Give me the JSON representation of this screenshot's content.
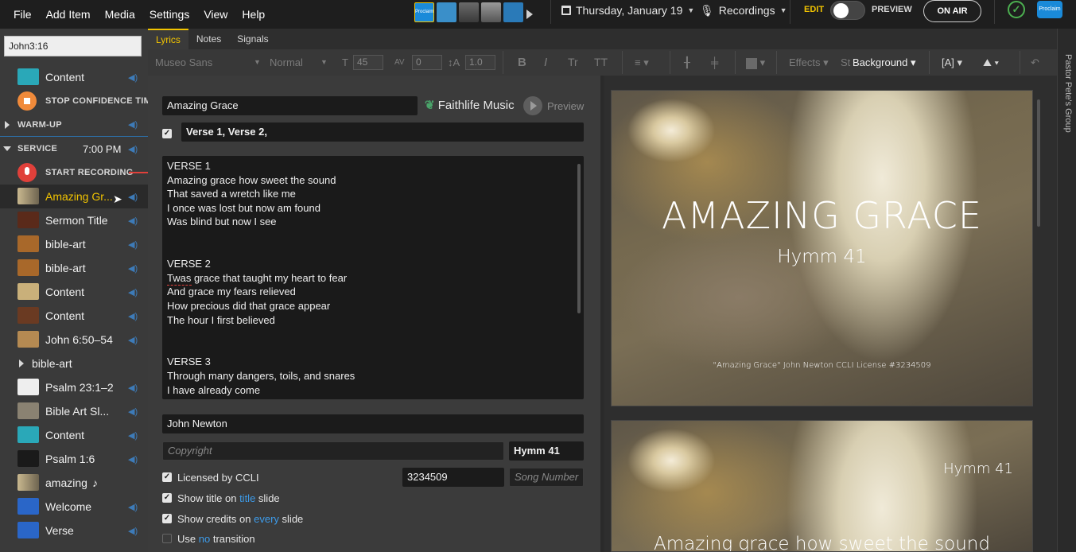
{
  "menu": [
    "File",
    "Add Item",
    "Media",
    "Settings",
    "View",
    "Help"
  ],
  "header": {
    "date": "Thursday, January 19",
    "recordings": "Recordings",
    "edit": "EDIT",
    "preview": "PREVIEW",
    "on_air": "ON AIR",
    "profile_badge": "Proclaim",
    "thumb_badge": "Proclaim"
  },
  "sidebar": {
    "search_value": "John3:16",
    "items": [
      {
        "label": "Content"
      },
      {
        "label": "STOP CONFIDENCE TIME"
      },
      {
        "label": "WARM-UP"
      },
      {
        "label": "SERVICE",
        "time": "7:00 PM"
      },
      {
        "label": "START RECORDING"
      },
      {
        "label": "Amazing Gr..."
      },
      {
        "label": "Sermon Title"
      },
      {
        "label": "bible-art"
      },
      {
        "label": "bible-art"
      },
      {
        "label": "Content"
      },
      {
        "label": "Content"
      },
      {
        "label": "John 6:50–54"
      },
      {
        "label": "bible-art"
      },
      {
        "label": "Psalm 23:1–2"
      },
      {
        "label": "Bible Art Sl..."
      },
      {
        "label": "Content"
      },
      {
        "label": "Psalm 1:6"
      },
      {
        "label": "amazing"
      },
      {
        "label": "Welcome"
      },
      {
        "label": "Verse"
      }
    ],
    "music_note": "♪"
  },
  "tabs": [
    "Lyrics",
    "Notes",
    "Signals"
  ],
  "toolbar": {
    "font": "Museo Sans",
    "weight": "Normal",
    "size": "45",
    "spacing": "0",
    "line_height": "1.0",
    "effects": "Effects",
    "styles": "St",
    "background": "Background"
  },
  "editor": {
    "song_title": "Amazing Grace",
    "faithlife": "Faithlife Music",
    "preview_btn": "Preview",
    "verse_order": "Verse 1, Verse 2,",
    "lyrics": [
      "VERSE 1",
      "Amazing grace how sweet the sound",
      "That saved a wretch like me",
      "I once was lost but now am found",
      "Was blind but now I see",
      "",
      "",
      "VERSE 2",
      "Twas grace that taught my heart to fear",
      "And grace my fears relieved",
      "How precious did that grace appear",
      "The hour I first believed",
      "",
      "",
      "VERSE 3",
      "Through many dangers, toils, and snares",
      "I have already come"
    ],
    "author": "John Newton",
    "copyright_placeholder": "Copyright",
    "hymn": "Hymm 41",
    "ccli_label": "Licensed by CCLI",
    "ccli_number": "3234509",
    "song_number_placeholder": "Song Number",
    "show_title_pre": "Show title on",
    "show_title_link": "title",
    "show_title_post": "slide",
    "show_credits_pre": "Show credits on",
    "show_credits_link": "every",
    "show_credits_post": "slide",
    "transition_pre": "Use",
    "transition_link": "no",
    "transition_post": "transition"
  },
  "preview": {
    "slide1_title": "AMAZING GRACE",
    "slide1_subtitle": "Hymm 41",
    "slide1_credit": "\"Amazing Grace\" John Newton CCLI License #3234509",
    "slide2_subtitle": "Hymm 41",
    "slide2_lyric": "Amazing grace how sweet the sound",
    "group_label": "Pastor Pete's Group"
  },
  "colors": {
    "accent": "#f2c400",
    "link_blue": "#3d9be9",
    "record_red": "#e0403a",
    "cue_orange": "#f08a3a",
    "teal_thumb": "#2aa8b8"
  }
}
